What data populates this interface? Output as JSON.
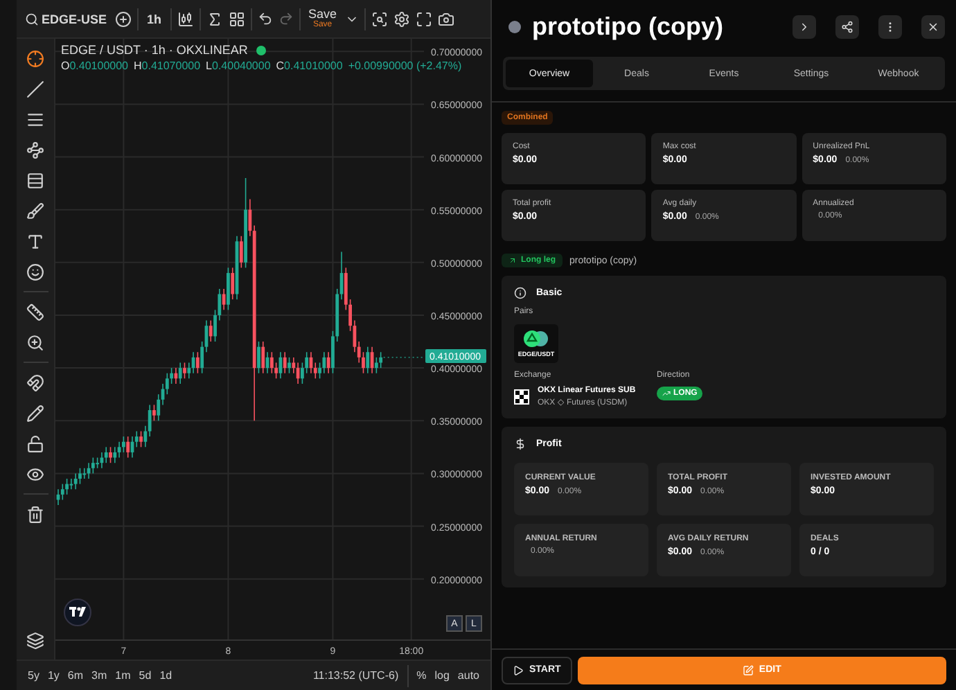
{
  "chart_toolbar": {
    "symbol": "EDGE-USE",
    "interval": "1h",
    "save_label": "Save",
    "save_status": "Save"
  },
  "chart": {
    "live": true,
    "ohlc": [
      {
        "label": "O",
        "value": "0.40100000"
      },
      {
        "label": "H",
        "value": "0.41070000"
      },
      {
        "label": "L",
        "value": "0.40040000"
      },
      {
        "label": "C",
        "value": "0.41010000"
      }
    ],
    "change": "+0.00990000 (+2.47%)",
    "last_price": "0.41010000",
    "scale_buttons": [
      "A",
      "L"
    ],
    "chart_data": {
      "type": "candlestick",
      "title": "EDGE / USDT · 1h · OKXLINEAR",
      "grid": true,
      "ylim": [
        0.142,
        0.712
      ],
      "categories": [
        null,
        null,
        null,
        null,
        null,
        null,
        null,
        null,
        null,
        null,
        null,
        null,
        null,
        null,
        null,
        "7",
        null,
        null,
        null,
        null,
        null,
        null,
        null,
        null,
        null,
        null,
        null,
        null,
        null,
        null,
        null,
        null,
        null,
        null,
        null,
        null,
        null,
        null,
        null,
        "8",
        null,
        null,
        null,
        null,
        null,
        null,
        null,
        null,
        null,
        null,
        null,
        null,
        null,
        null,
        null,
        null,
        null,
        null,
        null,
        null,
        null,
        null,
        null,
        "9",
        null,
        null,
        null,
        null,
        null,
        null,
        null,
        null,
        null,
        null,
        null,
        null,
        null,
        null,
        null,
        null,
        null,
        "18:00"
      ],
      "ohlc": [
        [
          0.275,
          0.285,
          0.27,
          0.28
        ],
        [
          0.28,
          0.29,
          0.275,
          0.285
        ],
        [
          0.285,
          0.295,
          0.28,
          0.29
        ],
        [
          0.29,
          0.295,
          0.285,
          0.29
        ],
        [
          0.29,
          0.3,
          0.285,
          0.295
        ],
        [
          0.295,
          0.305,
          0.29,
          0.3
        ],
        [
          0.3,
          0.305,
          0.295,
          0.3
        ],
        [
          0.3,
          0.31,
          0.295,
          0.305
        ],
        [
          0.305,
          0.315,
          0.3,
          0.31
        ],
        [
          0.31,
          0.315,
          0.305,
          0.31
        ],
        [
          0.31,
          0.32,
          0.305,
          0.315
        ],
        [
          0.315,
          0.325,
          0.31,
          0.32
        ],
        [
          0.32,
          0.325,
          0.31,
          0.315
        ],
        [
          0.315,
          0.325,
          0.31,
          0.32
        ],
        [
          0.32,
          0.33,
          0.315,
          0.325
        ],
        [
          0.325,
          0.335,
          0.32,
          0.33
        ],
        [
          0.33,
          0.335,
          0.315,
          0.32
        ],
        [
          0.32,
          0.335,
          0.315,
          0.33
        ],
        [
          0.33,
          0.34,
          0.325,
          0.335
        ],
        [
          0.335,
          0.34,
          0.325,
          0.33
        ],
        [
          0.33,
          0.345,
          0.325,
          0.34
        ],
        [
          0.34,
          0.365,
          0.335,
          0.36
        ],
        [
          0.36,
          0.365,
          0.35,
          0.355
        ],
        [
          0.355,
          0.375,
          0.35,
          0.37
        ],
        [
          0.37,
          0.385,
          0.365,
          0.38
        ],
        [
          0.38,
          0.395,
          0.375,
          0.39
        ],
        [
          0.39,
          0.4,
          0.385,
          0.395
        ],
        [
          0.395,
          0.4,
          0.385,
          0.39
        ],
        [
          0.39,
          0.405,
          0.385,
          0.4
        ],
        [
          0.4,
          0.405,
          0.39,
          0.395
        ],
        [
          0.395,
          0.405,
          0.39,
          0.4
        ],
        [
          0.4,
          0.415,
          0.395,
          0.41
        ],
        [
          0.41,
          0.415,
          0.395,
          0.4
        ],
        [
          0.4,
          0.425,
          0.395,
          0.42
        ],
        [
          0.42,
          0.445,
          0.415,
          0.44
        ],
        [
          0.44,
          0.445,
          0.425,
          0.43
        ],
        [
          0.43,
          0.455,
          0.425,
          0.45
        ],
        [
          0.45,
          0.475,
          0.445,
          0.47
        ],
        [
          0.47,
          0.475,
          0.455,
          0.46
        ],
        [
          0.46,
          0.495,
          0.455,
          0.49
        ],
        [
          0.49,
          0.495,
          0.465,
          0.47
        ],
        [
          0.47,
          0.525,
          0.465,
          0.52
        ],
        [
          0.52,
          0.525,
          0.495,
          0.5
        ],
        [
          0.5,
          0.58,
          0.495,
          0.55
        ],
        [
          0.55,
          0.56,
          0.525,
          0.53
        ],
        [
          0.53,
          0.535,
          0.35,
          0.4
        ],
        [
          0.4,
          0.425,
          0.395,
          0.42
        ],
        [
          0.42,
          0.425,
          0.395,
          0.4
        ],
        [
          0.4,
          0.415,
          0.395,
          0.41
        ],
        [
          0.41,
          0.415,
          0.395,
          0.4
        ],
        [
          0.4,
          0.405,
          0.39,
          0.395
        ],
        [
          0.395,
          0.415,
          0.39,
          0.41
        ],
        [
          0.41,
          0.415,
          0.395,
          0.4
        ],
        [
          0.4,
          0.41,
          0.395,
          0.405
        ],
        [
          0.405,
          0.41,
          0.395,
          0.4
        ],
        [
          0.4,
          0.405,
          0.385,
          0.39
        ],
        [
          0.39,
          0.405,
          0.385,
          0.4
        ],
        [
          0.4,
          0.415,
          0.395,
          0.41
        ],
        [
          0.41,
          0.415,
          0.395,
          0.4
        ],
        [
          0.4,
          0.405,
          0.39,
          0.395
        ],
        [
          0.395,
          0.405,
          0.39,
          0.4
        ],
        [
          0.4,
          0.415,
          0.395,
          0.41
        ],
        [
          0.41,
          0.415,
          0.395,
          0.4
        ],
        [
          0.4,
          0.435,
          0.395,
          0.43
        ],
        [
          0.43,
          0.475,
          0.425,
          0.47
        ],
        [
          0.47,
          0.51,
          0.465,
          0.49
        ],
        [
          0.49,
          0.495,
          0.455,
          0.46
        ],
        [
          0.46,
          0.465,
          0.435,
          0.44
        ],
        [
          0.44,
          0.445,
          0.415,
          0.42
        ],
        [
          0.42,
          0.425,
          0.405,
          0.41
        ],
        [
          0.41,
          0.415,
          0.395,
          0.4
        ],
        [
          0.4,
          0.42,
          0.395,
          0.415
        ],
        [
          0.415,
          0.42,
          0.395,
          0.4
        ],
        [
          0.4,
          0.41,
          0.395,
          0.405
        ],
        [
          0.405,
          0.415,
          0.4,
          0.41
        ],
        null,
        null,
        null,
        null,
        null,
        null,
        null
      ],
      "yticks": [
        {
          "value": 0.7,
          "label": "0.70000000"
        },
        {
          "value": 0.65,
          "label": "0.65000000"
        },
        {
          "value": 0.6,
          "label": "0.60000000"
        },
        {
          "value": 0.55,
          "label": "0.55000000"
        },
        {
          "value": 0.5,
          "label": "0.50000000"
        },
        {
          "value": 0.45,
          "label": "0.45000000"
        },
        {
          "value": 0.4,
          "label": "0.40000000"
        },
        {
          "value": 0.35,
          "label": "0.35000000"
        },
        {
          "value": 0.3,
          "label": "0.30000000"
        },
        {
          "value": 0.25,
          "label": "0.25000000"
        },
        {
          "value": 0.2,
          "label": "0.20000000"
        }
      ]
    }
  },
  "range_bar": {
    "ranges": [
      "5y",
      "1y",
      "6m",
      "3m",
      "1m",
      "5d",
      "1d"
    ],
    "time": "11:13:52 (UTC-6)",
    "options": [
      "%",
      "log",
      "auto"
    ]
  },
  "bot": {
    "title": "prototipo (copy)"
  },
  "tabs": [
    {
      "label": "Overview",
      "selected": true
    },
    {
      "label": "Deals",
      "selected": false
    },
    {
      "label": "Events",
      "selected": false
    },
    {
      "label": "Settings",
      "selected": false
    },
    {
      "label": "Webhook",
      "selected": false
    }
  ],
  "combined_badge": "Combined",
  "summary": [
    {
      "label": "Cost",
      "value": "$0.00"
    },
    {
      "label": "Max cost",
      "value": "$0.00"
    },
    {
      "label": "Unrealized PnL",
      "value": "$0.00",
      "pct": "0.00%"
    },
    {
      "label": "Total profit",
      "value": "$0.00"
    },
    {
      "label": "Avg daily",
      "value": "$0.00",
      "pct": "0.00%"
    },
    {
      "label": "Annualized",
      "pct": "0.00%"
    }
  ],
  "leg": {
    "badge": "Long leg",
    "name": "prototipo (copy)"
  },
  "basic": {
    "title": "Basic",
    "pairs_label": "Pairs",
    "pair": "EDGE/USDT",
    "exchange_label": "Exchange",
    "exchange_name": "OKX Linear Futures SUB",
    "exchange_sub": "OKX ◇ Futures (USDM)",
    "direction_label": "Direction",
    "direction": "LONG"
  },
  "profit": {
    "title": "Profit",
    "stats": [
      {
        "label": "CURRENT VALUE",
        "value": "$0.00",
        "pct": "0.00%"
      },
      {
        "label": "TOTAL PROFIT",
        "value": "$0.00",
        "pct": "0.00%"
      },
      {
        "label": "INVESTED AMOUNT",
        "value": "$0.00"
      },
      {
        "label": "ANNUAL RETURN",
        "pct": "0.00%"
      },
      {
        "label": "AVG DAILY RETURN",
        "value": "$0.00",
        "pct": "0.00%"
      },
      {
        "label": "DEALS",
        "value": "0 / 0"
      }
    ]
  },
  "actions": {
    "start": "START",
    "edit": "EDIT"
  }
}
